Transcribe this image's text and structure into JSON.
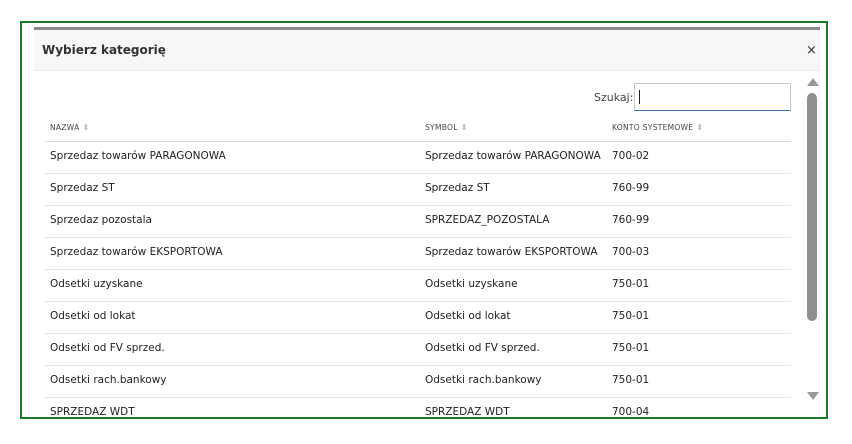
{
  "modal": {
    "title": "Wybierz kategorię",
    "close_glyph": "×",
    "search_label": "Szukaj:",
    "search_value": ""
  },
  "table": {
    "headers": [
      "NAZWA",
      "SYMBOL",
      "KONTO SYSTEMOWE"
    ],
    "sort_glyph": "⬍",
    "rows": [
      [
        "Sprzedaz towarów PARAGONOWA",
        "Sprzedaz towarów PARAGONOWA",
        "700-02"
      ],
      [
        "Sprzedaz ST",
        "Sprzedaz ST",
        "760-99"
      ],
      [
        "Sprzedaz pozostala",
        "SPRZEDAZ_POZOSTALA",
        "760-99"
      ],
      [
        "Sprzedaz towarów EKSPORTOWA",
        "Sprzedaz towarów EKSPORTOWA",
        "700-03"
      ],
      [
        "Odsetki uzyskane",
        "Odsetki uzyskane",
        "750-01"
      ],
      [
        "Odsetki od lokat",
        "Odsetki od lokat",
        "750-01"
      ],
      [
        "Odsetki od FV sprzed.",
        "Odsetki od FV sprzed.",
        "750-01"
      ],
      [
        "Odsetki rach.bankowy",
        "Odsetki rach.bankowy",
        "750-01"
      ],
      [
        "SPRZEDAZ WDT",
        "SPRZEDAZ WDT",
        "700-04"
      ]
    ]
  },
  "colors": {
    "frame_border": "#1f7a2a",
    "scroll_thumb": "#8f8f8f"
  }
}
